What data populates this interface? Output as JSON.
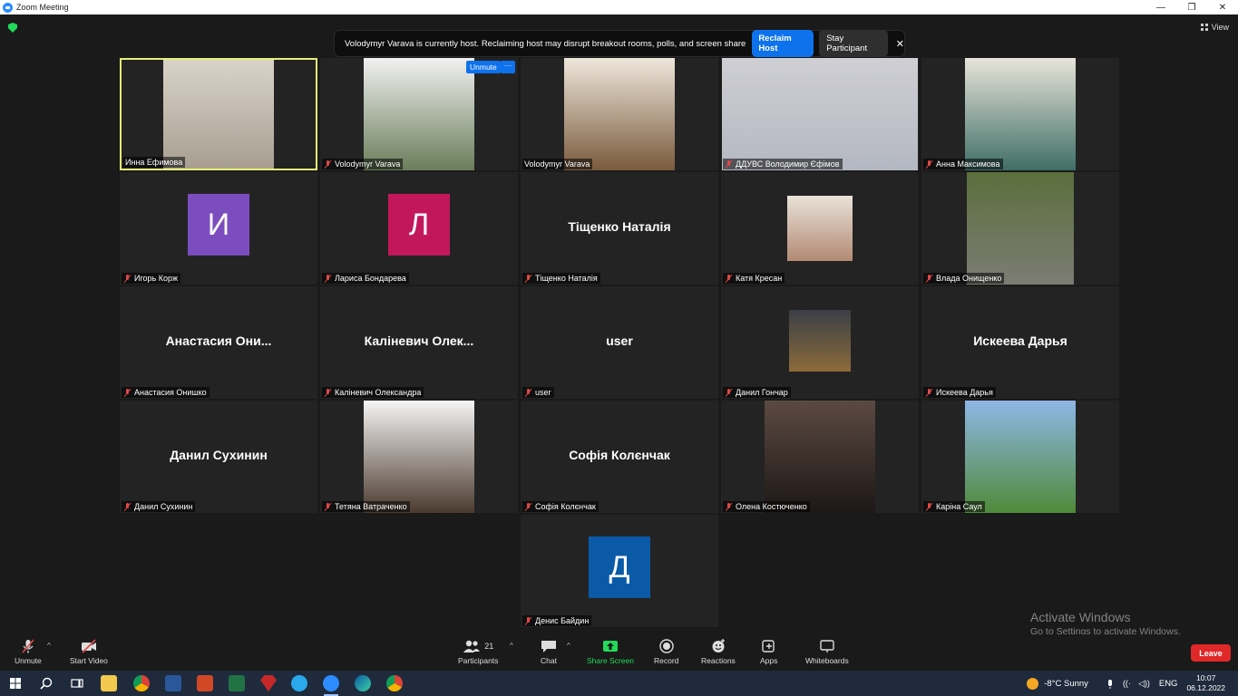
{
  "window": {
    "title": "Zoom Meeting",
    "controls": [
      "—",
      "❐",
      "✕"
    ]
  },
  "view_label": "View",
  "host_banner": {
    "message": "Volodymyr Varava is currently host. Reclaiming host may disrupt breakout rooms, polls, and screen share",
    "reclaim_label": "Reclaim Host",
    "stay_label": "Stay Participant",
    "close_glyph": "✕"
  },
  "tile_overlay": {
    "unmute_label": "Unmute",
    "more_glyph": "···"
  },
  "participants": [
    {
      "label": "Инна Ефимова",
      "kind": "video",
      "active": true
    },
    {
      "label": "Volodymyr Varava",
      "kind": "video"
    },
    {
      "label": "Volodymyr Varava",
      "kind": "video"
    },
    {
      "label": "ДДУВС Володимир Єфімов",
      "kind": "video"
    },
    {
      "label": "Анна Максимова",
      "kind": "video"
    },
    {
      "label": "Игорь Корж",
      "kind": "avatar",
      "initial": "И",
      "color": "#7c4dbf"
    },
    {
      "label": "Лариса Бондарева",
      "kind": "avatar",
      "initial": "Л",
      "color": "#c2185b"
    },
    {
      "label": "Тіщенко Наталія",
      "kind": "name",
      "display": "Тіщенко Наталія"
    },
    {
      "label": "Катя Кресан",
      "kind": "video"
    },
    {
      "label": "Влада Онищенко",
      "kind": "video"
    },
    {
      "label": "Анастасия Онишко",
      "kind": "name",
      "display": "Анастасия  Они..."
    },
    {
      "label": "Каліневич Олександра",
      "kind": "name",
      "display": "Каліневич  Олек..."
    },
    {
      "label": "user",
      "kind": "name",
      "display": "user"
    },
    {
      "label": "Данил Гончар",
      "kind": "video"
    },
    {
      "label": "Искеева Дарья",
      "kind": "name",
      "display": "Искеева Дарья"
    },
    {
      "label": "Данил Сухинин",
      "kind": "name",
      "display": "Данил Сухинин"
    },
    {
      "label": "Тетяна Ватраченко",
      "kind": "video"
    },
    {
      "label": "Софія Колєнчак",
      "kind": "name",
      "display": "Софія Колєнчак"
    },
    {
      "label": "Олена Костюченко",
      "kind": "video"
    },
    {
      "label": "Каріна Саул",
      "kind": "video"
    },
    {
      "label": "Денис Байдин",
      "kind": "avatar",
      "initial": "Д",
      "color": "#0a5aa8"
    }
  ],
  "activate_windows": {
    "title": "Activate Windows",
    "subtitle": "Go to Settings to activate Windows."
  },
  "toolbar": {
    "unmute": "Unmute",
    "start_video": "Start Video",
    "participants": "Participants",
    "participant_count": "21",
    "chat": "Chat",
    "share_screen": "Share Screen",
    "record": "Record",
    "reactions": "Reactions",
    "apps": "Apps",
    "whiteboards": "Whiteboards",
    "leave": "Leave",
    "caret": "^"
  },
  "taskbar": {
    "weather": "-8°C  Sunny",
    "language": "ENG",
    "time": "10:07",
    "date": "06.12.2022"
  }
}
